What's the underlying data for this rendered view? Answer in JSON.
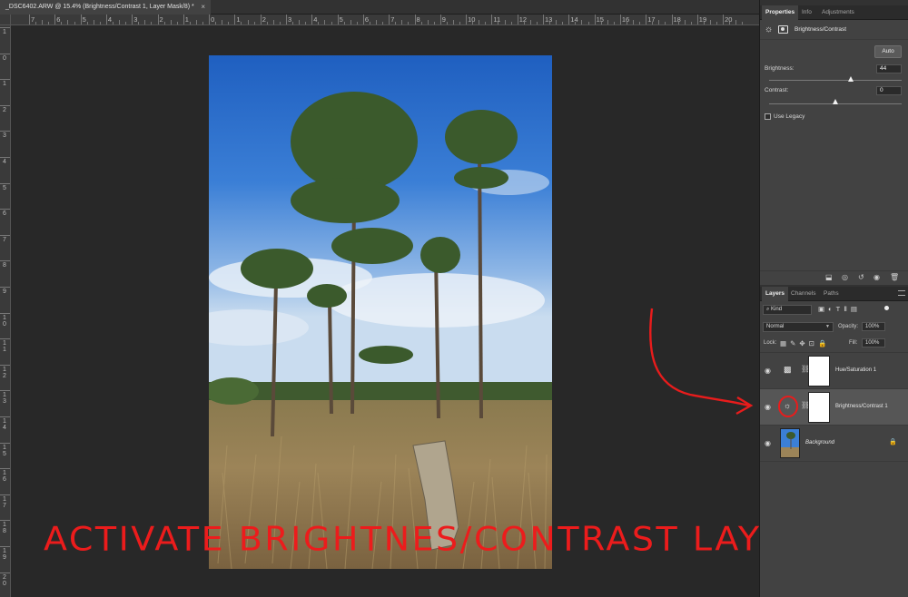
{
  "document": {
    "tab_title": "_DSC6402.ARW @ 15.4% (Brightness/Contrast 1, Layer Mask/8) *",
    "close_glyph": "×"
  },
  "ruler": {
    "top_labels": [
      "7",
      "6",
      "5",
      "4",
      "3",
      "2",
      "1",
      "0",
      "1",
      "2",
      "3",
      "4",
      "5",
      "6",
      "7",
      "8",
      "9",
      "10",
      "11",
      "12",
      "13",
      "14",
      "15",
      "16",
      "17",
      "18",
      "19",
      "20"
    ],
    "left_labels": [
      "1",
      "0",
      "1",
      "2",
      "3",
      "4",
      "5",
      "6",
      "7",
      "8",
      "9",
      "1 0",
      "1 1",
      "1 2",
      "1 3",
      "1 4",
      "1 5",
      "1 6",
      "1 7",
      "1 8",
      "1 9",
      "2 0"
    ]
  },
  "annotation": {
    "text": "ACTIVATE BRIGHTNES/CONTRAST LAYER",
    "color": "#ec1c1c"
  },
  "properties_panel": {
    "tabs": [
      "Properties",
      "Info",
      "Adjustments"
    ],
    "active_tab": "Properties",
    "adjustment_title": "Brightness/Contrast",
    "auto_label": "Auto",
    "brightness_label": "Brightness:",
    "brightness_value": "44",
    "brightness_fraction": 0.62,
    "contrast_label": "Contrast:",
    "contrast_value": "0",
    "contrast_fraction": 0.5,
    "legacy_label": "Use Legacy",
    "footer_icons": [
      "clip-to-layer-icon",
      "view-previous-icon",
      "reset-icon",
      "visibility-icon",
      "trash-icon"
    ]
  },
  "layers_panel": {
    "tabs": [
      "Layers",
      "Channels",
      "Paths"
    ],
    "active_tab": "Layers",
    "filter_label": "Kind",
    "blend_mode": "Normal",
    "opacity_label": "Opacity:",
    "opacity_value": "100%",
    "lock_label": "Lock:",
    "fill_label": "Fill:",
    "fill_value": "100%",
    "layers": [
      {
        "name": "Hue/Saturation 1",
        "type": "adjustment",
        "icon": "hue-saturation-icon",
        "selected": false
      },
      {
        "name": "Brightness/Contrast 1",
        "type": "adjustment",
        "icon": "brightness-icon",
        "selected": true
      },
      {
        "name": "Background",
        "type": "pixel",
        "icon": "photo-thumbnail",
        "selected": false,
        "locked": true
      }
    ]
  }
}
